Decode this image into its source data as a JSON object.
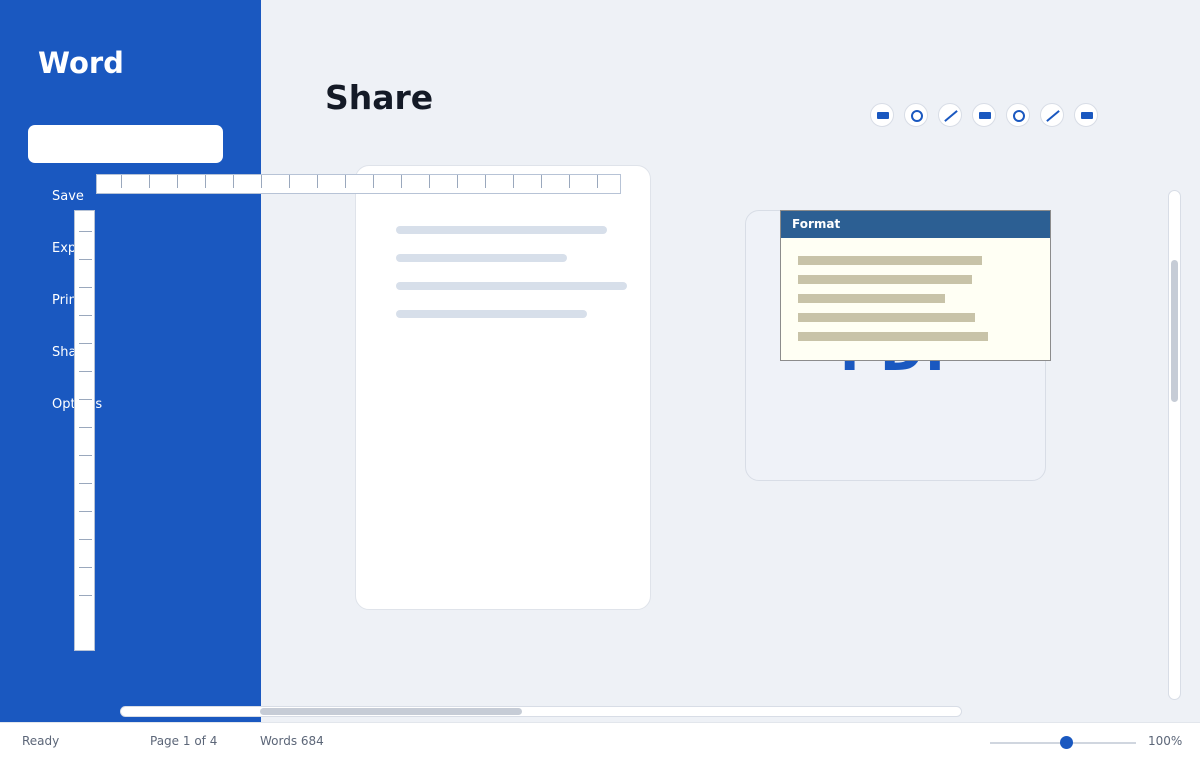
{
  "app": {
    "title": "Word"
  },
  "sidebar": {
    "search_placeholder": "",
    "items": [
      {
        "label": "Save"
      },
      {
        "label": "Export"
      },
      {
        "label": "Print"
      },
      {
        "label": "Share"
      },
      {
        "label": "Options"
      }
    ]
  },
  "main": {
    "title": "Share",
    "tools": [
      "rectangle-icon",
      "circle-icon",
      "line-icon",
      "rectangle-icon",
      "circle-icon",
      "line-icon",
      "rectangle-icon"
    ],
    "pdf_card": {
      "label": "PDF"
    }
  },
  "popup": {
    "title": "Format"
  },
  "status": {
    "state": "Ready",
    "page": "Page 1 of 4",
    "words": "Words 684",
    "zoom": "100%",
    "zoom_slider_value": 0.5
  },
  "colors": {
    "accent": "#1a58c0",
    "popup_header": "#2c5f93"
  }
}
